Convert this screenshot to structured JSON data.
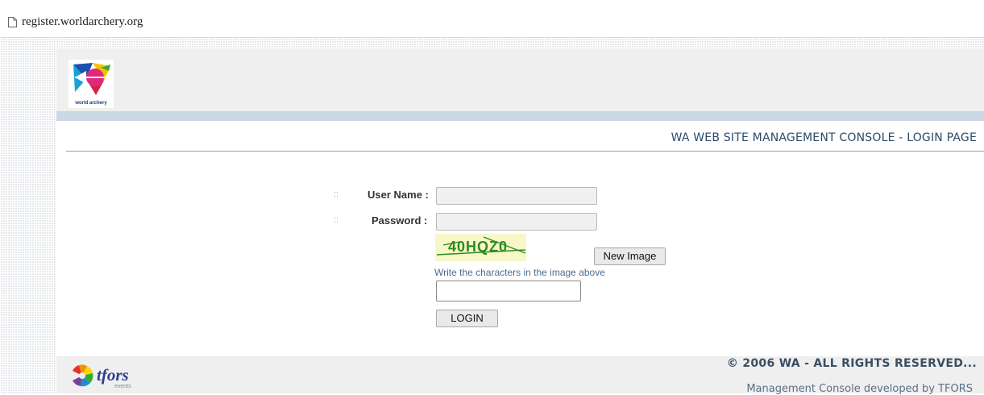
{
  "browser": {
    "url": "register.worldarchery.org"
  },
  "header": {
    "logo_caption": "world archery"
  },
  "main": {
    "title": "WA WEB SITE MANAGEMENT CONSOLE - LOGIN PAGE",
    "bullet": "::",
    "username_label": "User Name :",
    "username_value": "",
    "password_label": "Password :",
    "password_value": "",
    "captcha_text": "40HQZ0",
    "new_image_label": "New Image",
    "captcha_hint": "Write the characters in the image above",
    "captcha_value": "",
    "login_label": "LOGIN"
  },
  "footer": {
    "copyright": "© 2006 WA - ALL RIGHTS RESERVED...",
    "developed_by": "Management Console developed by TFORS",
    "tfors_logo_text": "tfors",
    "tfors_logo_subtext": "events"
  },
  "colors": {
    "header_strip": "#cbd7e2",
    "title_text": "#2c4a68",
    "hint_text": "#4a6d91",
    "captcha_green": "#2f8a1f"
  }
}
